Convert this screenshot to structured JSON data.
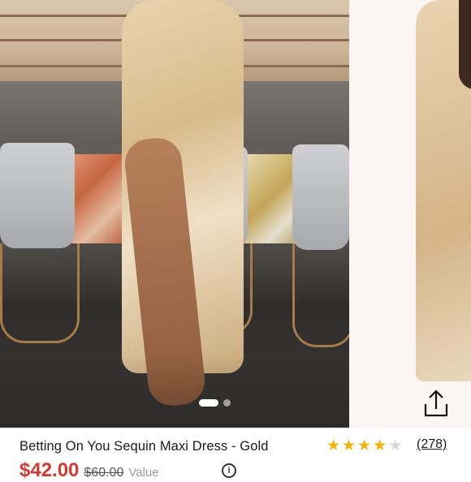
{
  "carousel": {
    "slide_count": 2,
    "active_slide": 1
  },
  "product": {
    "title": "Betting On You Sequin Maxi Dress - Gold",
    "rating": 4,
    "rating_max": 5,
    "reviews_label": "(278)",
    "price": "$42.00",
    "original_price": "$60.00",
    "value_label": "Value",
    "star_color_filled": "#f5b301",
    "star_color_empty": "#d6d6d6",
    "price_color": "#d63a2f"
  },
  "icons": {
    "share": "share-icon",
    "info": "info-icon",
    "star": "star-icon"
  }
}
